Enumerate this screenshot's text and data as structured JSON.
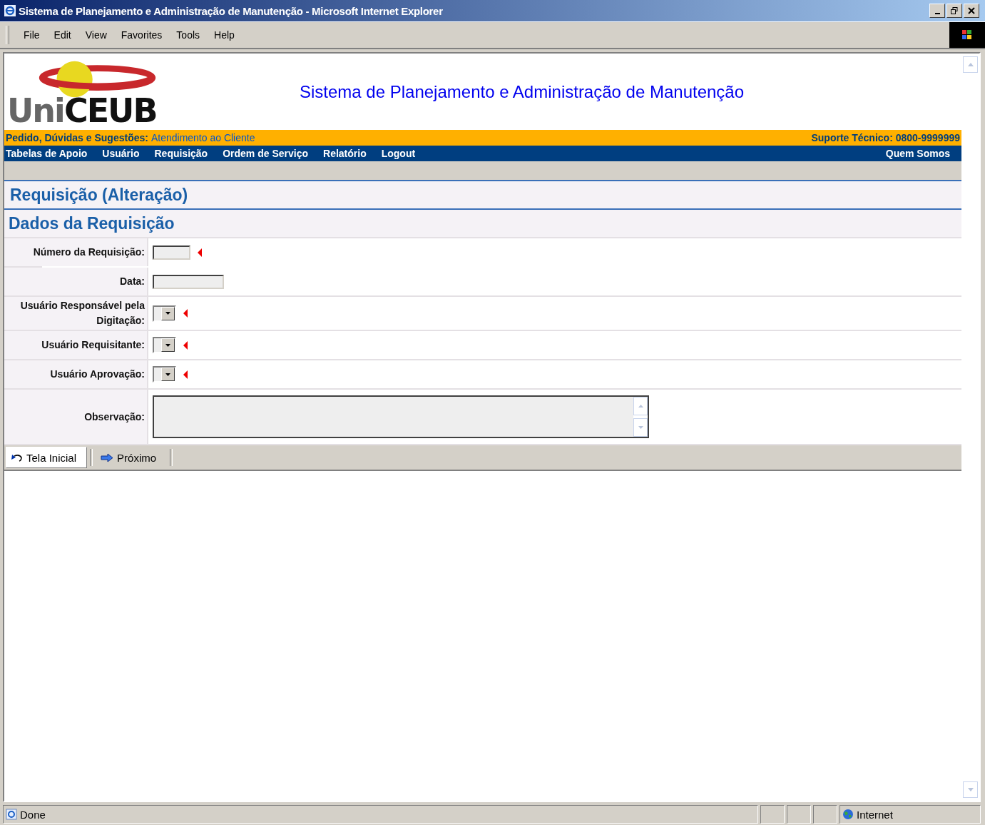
{
  "window": {
    "title": "Sistema de Planejamento e Administração de Manutenção - Microsoft Internet Explorer"
  },
  "menu": [
    "File",
    "Edit",
    "View",
    "Favorites",
    "Tools",
    "Help"
  ],
  "logo": {
    "prefix": "Uni",
    "main": "CEUB"
  },
  "site_title": "Sistema de Planejamento e Administração de Manutenção",
  "info_bar": {
    "label": "Pedido, Dúvidas e Sugestões:",
    "link": "Atendimento ao Cliente",
    "support": "Suporte Técnico: 0800-9999999"
  },
  "nav": {
    "items": [
      "Tabelas de Apoio",
      "Usuário",
      "Requisição",
      "Ordem de Serviço",
      "Relatório",
      "Logout"
    ],
    "right": "Quem Somos"
  },
  "page_title": "Requisição (Alteração)",
  "section_title": "Dados da Requisição",
  "form_rows": [
    {
      "label": "Número da Requisição:",
      "kind": "short",
      "required": true
    },
    {
      "label": "Data:",
      "kind": "text",
      "required": false
    },
    {
      "label": "Usuário Responsável pela Digitação:",
      "kind": "select",
      "required": true
    },
    {
      "label": "Usuário Requisitante:",
      "kind": "select",
      "required": true
    },
    {
      "label": "Usuário Aprovação:",
      "kind": "select",
      "required": true
    },
    {
      "label": "Observação:",
      "kind": "textarea",
      "required": false
    }
  ],
  "toolbar": [
    {
      "label": "Tela Inicial",
      "kind": "back",
      "selected": true
    },
    {
      "label": "Próximo",
      "kind": "next",
      "selected": false
    }
  ],
  "status_bar": {
    "text": "Done",
    "zone": "Internet"
  }
}
